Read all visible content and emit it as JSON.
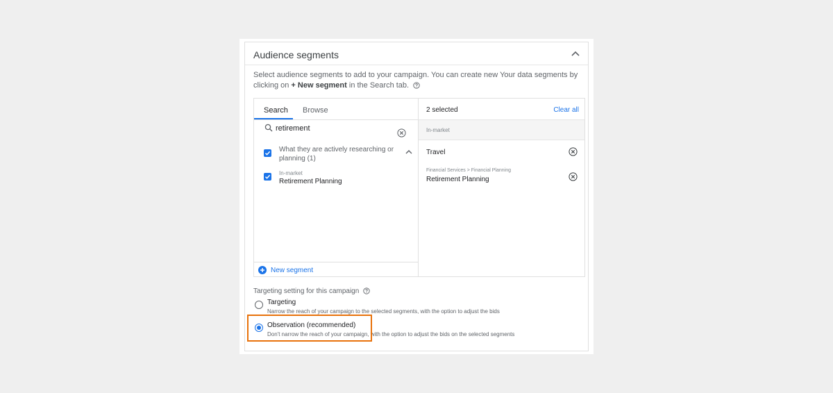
{
  "section": {
    "title": "Audience segments",
    "description_pre": "Select audience segments to add to your campaign. You can create new Your data segments by clicking on ",
    "description_bold": "+ New segment",
    "description_post": " in the Search tab."
  },
  "tabs": [
    {
      "label": "Search",
      "active": true
    },
    {
      "label": "Browse",
      "active": false
    }
  ],
  "search": {
    "value": "retirement",
    "placeholder": ""
  },
  "results": [
    {
      "label": "What they are actively researching or planning (1)",
      "checked": true
    },
    {
      "category": "In-market",
      "label": "Retirement Planning",
      "checked": true
    }
  ],
  "new_segment_label": "New segment",
  "selected_panel": {
    "count_label": "2 selected",
    "clear_all_label": "Clear all",
    "group_label": "In-market",
    "items": [
      {
        "path": "",
        "label": "Travel"
      },
      {
        "path": "Financial Services > Financial Planning",
        "label": "Retirement Planning"
      }
    ]
  },
  "targeting": {
    "label": "Targeting setting for this campaign",
    "options": [
      {
        "title": "Targeting",
        "desc": "Narrow the reach of your campaign to the selected segments, with the option to adjust the bids",
        "selected": false
      },
      {
        "title": "Observation (recommended)",
        "desc": "Don't narrow the reach of your campaign, with the option to adjust the bids on the selected segments",
        "selected": true
      }
    ]
  },
  "colors": {
    "accent": "#1a73e8",
    "highlight": "#e8710a"
  },
  "icons": [
    "chevron-up-icon",
    "help-icon",
    "search-icon",
    "clear-circle-icon",
    "check-icon",
    "plus-icon"
  ]
}
